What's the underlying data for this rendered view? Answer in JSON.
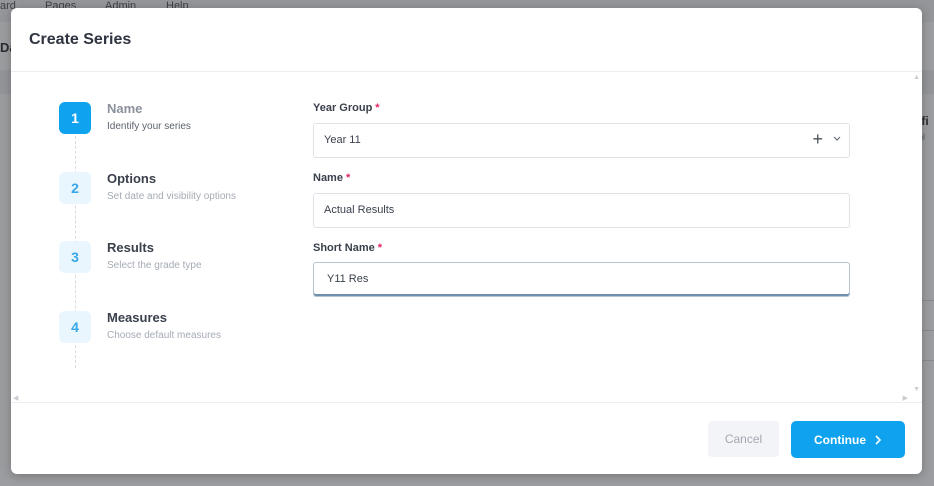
{
  "background": {
    "nav_items": [
      "ard",
      "Pages",
      "Admin",
      "Help"
    ],
    "sub_title": "Da",
    "right_text": "nfi",
    "right_sub": "pl"
  },
  "modal": {
    "title": "Create Series"
  },
  "stepper": {
    "steps": [
      {
        "number": "1",
        "title": "Name",
        "subtitle": "Identify your series",
        "active": true
      },
      {
        "number": "2",
        "title": "Options",
        "subtitle": "Set date and visibility options",
        "active": false
      },
      {
        "number": "3",
        "title": "Results",
        "subtitle": "Select the grade type",
        "active": false
      },
      {
        "number": "4",
        "title": "Measures",
        "subtitle": "Choose default measures",
        "active": false
      }
    ]
  },
  "form": {
    "year_group": {
      "label": "Year Group",
      "required_mark": "*",
      "value": "Year 11"
    },
    "name": {
      "label": "Name",
      "required_mark": "*",
      "value": "Actual Results"
    },
    "short_name": {
      "label": "Short Name",
      "required_mark": "*",
      "value": "Y11 Res"
    }
  },
  "footer": {
    "cancel_label": "Cancel",
    "continue_label": "Continue"
  },
  "icons": {
    "add": "plus-icon",
    "dropdown": "chevron-down-icon",
    "next": "chevron-right-icon"
  },
  "colors": {
    "accent": "#0ea2ef",
    "required": "#e0245e"
  }
}
